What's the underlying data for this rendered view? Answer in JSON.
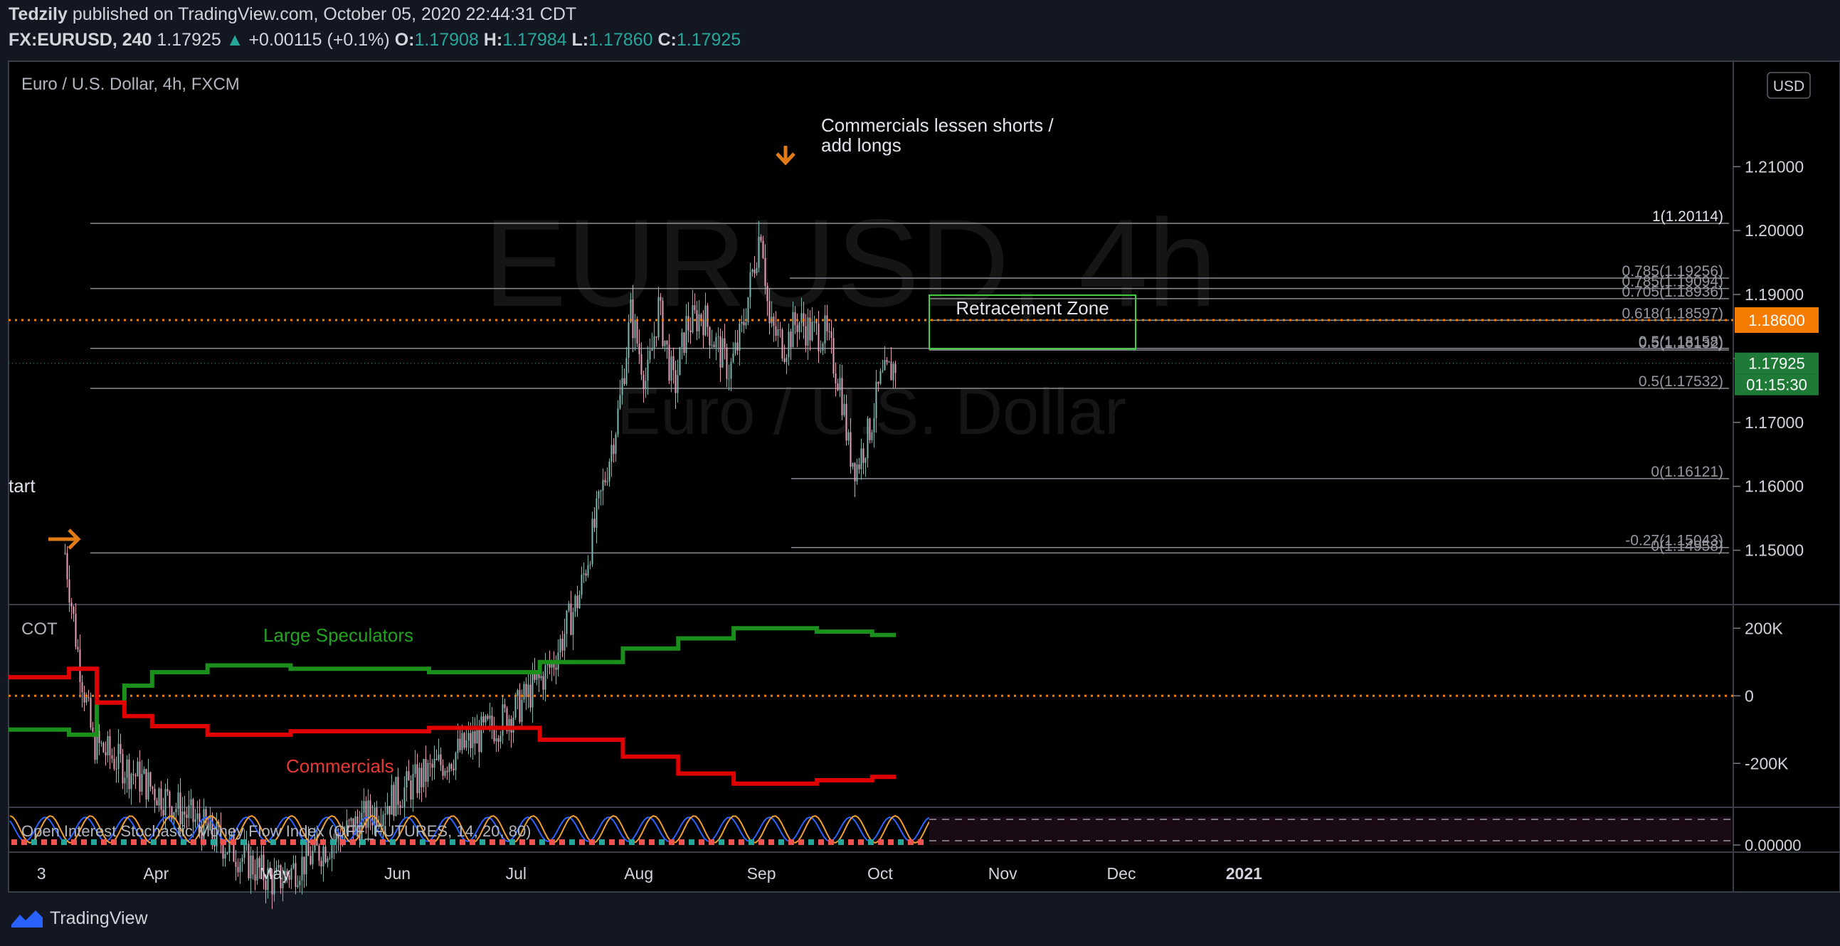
{
  "header": {
    "line1_user": "Tedzily",
    "line1_rest": "published on TradingView.com, October 05, 2020 22:44:31 CDT",
    "symbol": "FX:EURUSD, 240",
    "last": "1.17925",
    "change": "+0.00115 (+0.1%)",
    "o_label": "O:",
    "o": "1.17908",
    "h_label": "H:",
    "h": "1.17984",
    "l_label": "L:",
    "l": "1.17860",
    "c_label": "C:",
    "c": "1.17925"
  },
  "main_pane": {
    "title": "Euro / U.S. Dollar, 4h, FXCM",
    "watermark_big": "EURUSD, 4h",
    "watermark_small": "Euro / U.S. Dollar",
    "currency_badge": "USD",
    "annotation_top": [
      "Commercials lessen shorts /",
      "add longs"
    ],
    "annotation_left": "tart",
    "retracement_label": "Retracement Zone",
    "price_tag": "1.17925",
    "countdown": "01:15:30",
    "level_tag": "1.18600"
  },
  "cot_pane": {
    "title": "COT",
    "label_spec": "Large Speculators",
    "label_comm": "Commercials",
    "ticks": [
      "200K",
      "0",
      "-200K"
    ]
  },
  "oi_pane": {
    "title": "Open Interest Stochastic Money Flow Index (OFF_FUTURES, 14, 20, 80)",
    "tick": "0.00000"
  },
  "footer": {
    "brand": "TradingView"
  },
  "colors": {
    "up": "#26a69a",
    "down": "#ef5350",
    "spec": "#1b8f1b",
    "comm": "#e10000",
    "orange": "#f57c00",
    "bg": "#000000"
  },
  "chart_data": [
    {
      "type": "line",
      "title": "Euro / U.S. Dollar, 4h, FXCM",
      "series": [
        {
          "name": "EURUSD",
          "x": [
            "2020-03-09",
            "2020-03-12",
            "2020-03-16",
            "2020-05-01",
            "2020-07-01",
            "2020-07-10",
            "2020-07-17",
            "2020-07-22",
            "2020-07-24",
            "2020-07-27",
            "2020-07-30",
            "2020-08-03",
            "2020-08-06",
            "2020-08-10",
            "2020-08-13",
            "2020-08-17",
            "2020-08-20",
            "2020-08-24",
            "2020-08-27",
            "2020-09-01",
            "2020-09-03",
            "2020-09-07",
            "2020-09-10",
            "2020-09-14",
            "2020-09-17",
            "2020-09-21",
            "2020-09-23",
            "2020-09-25",
            "2020-09-28",
            "2020-10-01",
            "2020-10-05"
          ],
          "y": [
            1.1496,
            1.135,
            1.12,
            1.098,
            1.125,
            1.132,
            1.143,
            1.157,
            1.163,
            1.172,
            1.187,
            1.176,
            1.188,
            1.175,
            1.185,
            1.187,
            1.183,
            1.178,
            1.184,
            1.2011,
            1.185,
            1.182,
            1.186,
            1.184,
            1.184,
            1.176,
            1.166,
            1.163,
            1.168,
            1.176,
            1.1792
          ]
        }
      ],
      "fib_levels": [
        {
          "label": "1(1.20114)",
          "value": 1.20114
        },
        {
          "label": "0.785(1.19256)",
          "value": 1.19256
        },
        {
          "label": "0.785(1.19094)",
          "value": 1.19094
        },
        {
          "label": "0.705(1.18936)",
          "value": 1.18936
        },
        {
          "label": "0.618(1.18597)",
          "value": 1.18597
        },
        {
          "label": "0.5(1.18158)",
          "value": 1.18158
        },
        {
          "label": "0.5(1.18132)",
          "value": 1.18132
        },
        {
          "label": "0.5(1.17532)",
          "value": 1.17532
        },
        {
          "label": "0(1.16121)",
          "value": 1.16121
        },
        {
          "label": "-0.27(1.15043)",
          "value": 1.15043
        },
        {
          "label": "0(1.14958)",
          "value": 1.14958
        }
      ],
      "horizontal_level": 1.186,
      "last_price": 1.17925,
      "retracement_zone": {
        "y_top": 1.1899,
        "y_bottom": 1.1815
      },
      "xlabel": "",
      "ylabel": "",
      "x_ticks": [
        "3",
        "Apr",
        "May",
        "Jun",
        "Jul",
        "Aug",
        "Sep",
        "Oct",
        "Nov",
        "Dec",
        "2021"
      ],
      "y_ticks": [
        "1.21000",
        "1.20000",
        "1.19000",
        "1.18000",
        "1.17000",
        "1.16000",
        "1.15000"
      ],
      "ylim": [
        1.1415,
        1.2265
      ]
    },
    {
      "type": "line",
      "title": "COT",
      "series": [
        {
          "name": "Large Speculators",
          "x": [
            "2020-03-03",
            "2020-03-10",
            "2020-03-17",
            "2020-03-24",
            "2020-03-31",
            "2020-04-14",
            "2020-05-05",
            "2020-06-09",
            "2020-07-07",
            "2020-07-28",
            "2020-08-11",
            "2020-08-25",
            "2020-09-15",
            "2020-09-29",
            "2020-10-05"
          ],
          "y": [
            -100000,
            -115000,
            -20000,
            30000,
            70000,
            90000,
            80000,
            70000,
            100000,
            140000,
            170000,
            200000,
            190000,
            180000,
            180000
          ]
        },
        {
          "name": "Commercials",
          "x": [
            "2020-03-03",
            "2020-03-10",
            "2020-03-17",
            "2020-03-24",
            "2020-03-31",
            "2020-04-14",
            "2020-05-05",
            "2020-06-09",
            "2020-07-07",
            "2020-07-28",
            "2020-08-11",
            "2020-08-25",
            "2020-09-15",
            "2020-09-29",
            "2020-10-05"
          ],
          "y": [
            55000,
            80000,
            -20000,
            -60000,
            -90000,
            -115000,
            -105000,
            -95000,
            -130000,
            -180000,
            -230000,
            -260000,
            -250000,
            -240000,
            -240000
          ]
        }
      ],
      "y_ticks": [
        "200K",
        "0",
        "-200K"
      ],
      "ylim": [
        -330000,
        270000
      ]
    }
  ]
}
